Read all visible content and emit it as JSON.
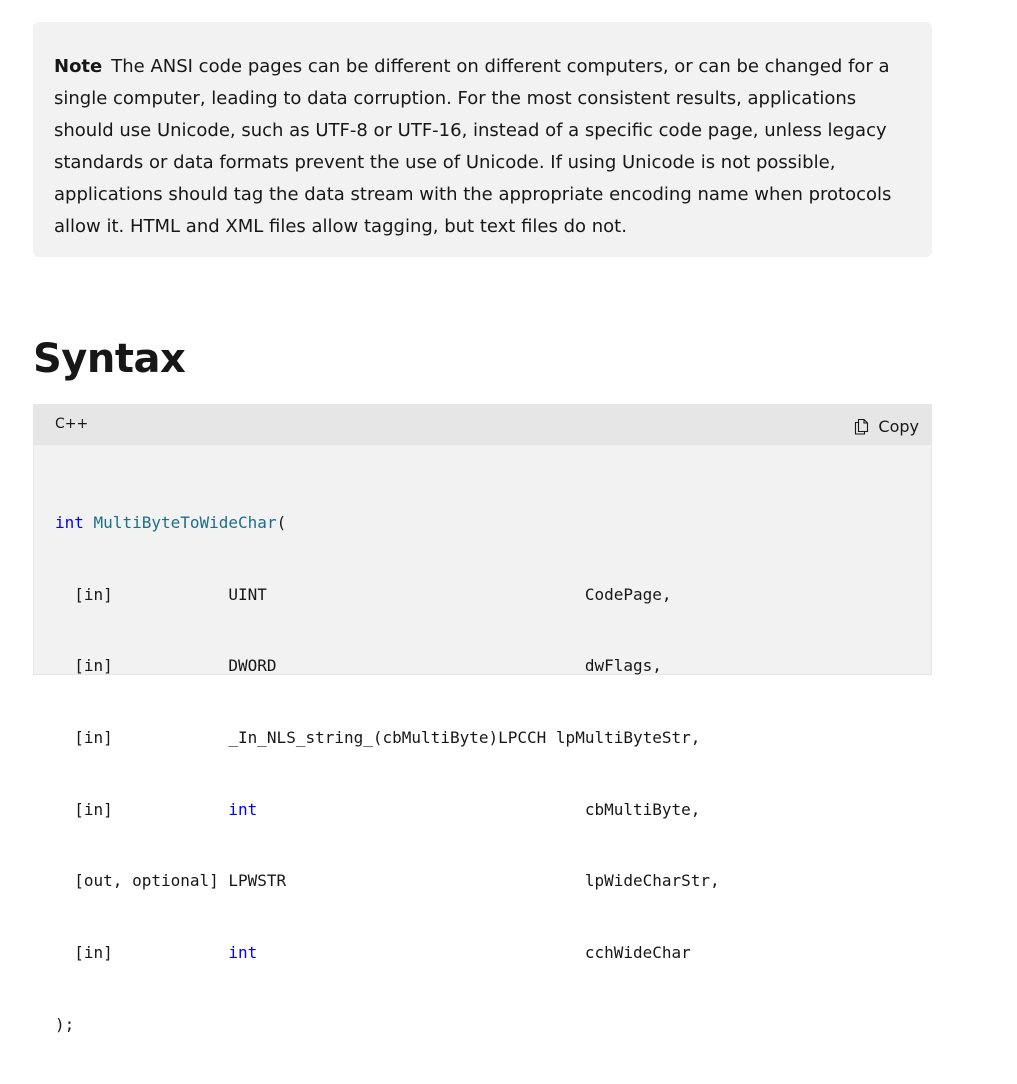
{
  "note": {
    "label": "Note",
    "text": "The ANSI code pages can be different on different computers, or can be changed for a single computer, leading to data corruption. For the most consistent results, applications should use Unicode, such as UTF-8 or UTF-16, instead of a specific code page, unless legacy standards or data formats prevent the use of Unicode. If using Unicode is not possible, applications should tag the data stream with the appropriate encoding name when protocols allow it. HTML and XML files allow tagging, but text files do not."
  },
  "syntax": {
    "heading": "Syntax",
    "language": "C++",
    "copy_label": "Copy",
    "copy_icon": "copy-icon",
    "code": {
      "return_type": "int",
      "function_name": "MultiByteToWideChar",
      "open_paren": "(",
      "close": ");",
      "params": [
        {
          "annotation": "  [in]            ",
          "type": "UINT",
          "type_pad": "                                 ",
          "name": "CodePage,",
          "type_is_keyword": false
        },
        {
          "annotation": "  [in]            ",
          "type": "DWORD",
          "type_pad": "                                ",
          "name": "dwFlags,",
          "type_is_keyword": false
        },
        {
          "annotation": "  [in]            ",
          "type": "_In_NLS_string_(cbMultiByte)LPCCH",
          "type_pad": " ",
          "name": "lpMultiByteStr,",
          "type_is_keyword": false
        },
        {
          "annotation": "  [in]            ",
          "type": "int",
          "type_pad": "                                  ",
          "name": "cbMultiByte,",
          "type_is_keyword": true
        },
        {
          "annotation": "  [out, optional] ",
          "type": "LPWSTR",
          "type_pad": "                               ",
          "name": "lpWideCharStr,",
          "type_is_keyword": false
        },
        {
          "annotation": "  [in]            ",
          "type": "int",
          "type_pad": "                                  ",
          "name": "cchWideChar",
          "type_is_keyword": true
        }
      ]
    }
  },
  "colors": {
    "note_background": "#f2f2f2",
    "code_background": "#f2f2f2",
    "code_header_background": "#e6e6e6",
    "keyword": "#0101fd",
    "function_name": "#1c6e8b"
  }
}
